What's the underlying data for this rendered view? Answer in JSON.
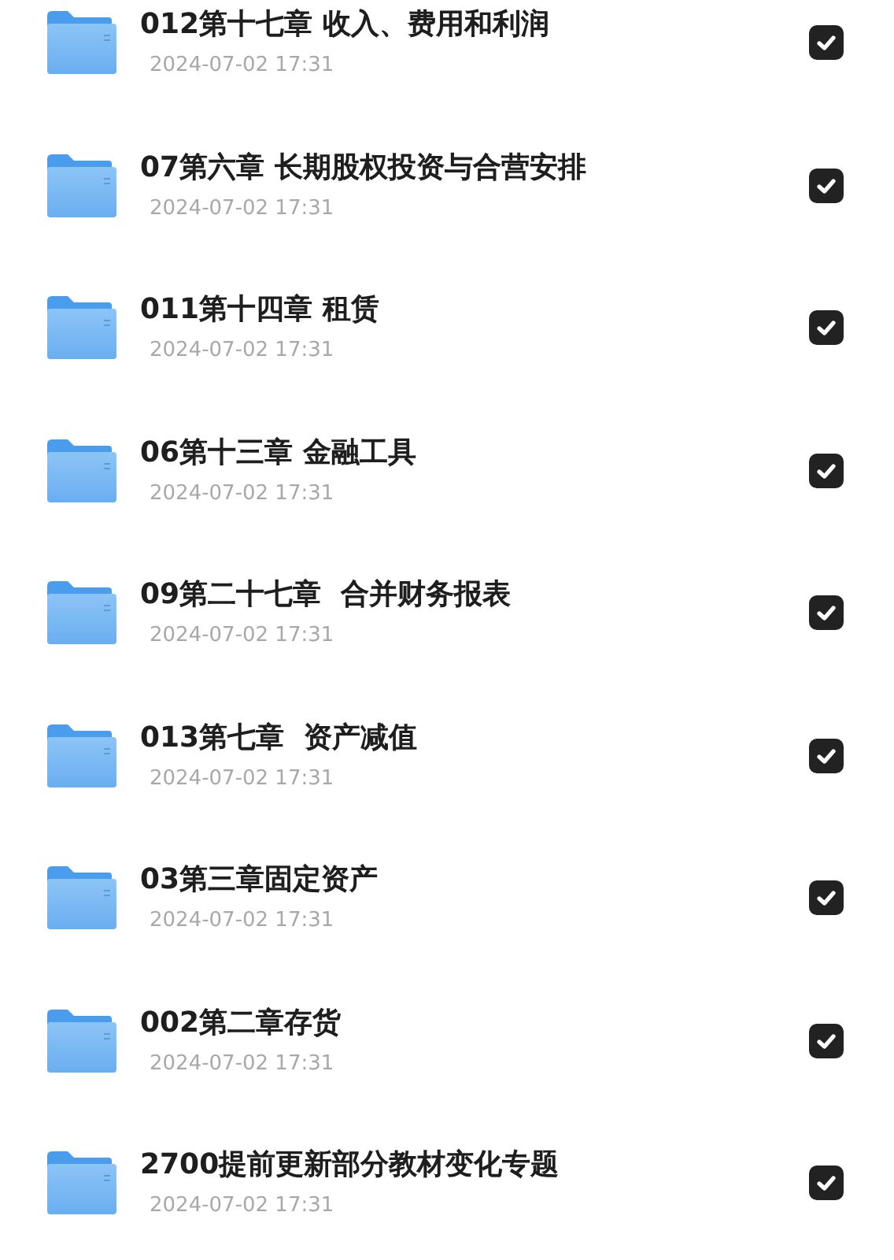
{
  "files": [
    {
      "name": "012第十七章 收入、费用和利润",
      "date": "2024-07-02 17:31",
      "checked": true
    },
    {
      "name": "07第六章 长期股权投资与合营安排",
      "date": "2024-07-02 17:31",
      "checked": true
    },
    {
      "name": "011第十四章 租赁",
      "date": "2024-07-02 17:31",
      "checked": true
    },
    {
      "name": "06第十三章 金融工具",
      "date": "2024-07-02 17:31",
      "checked": true
    },
    {
      "name": "09第二十七章  合并财务报表",
      "date": "2024-07-02 17:31",
      "checked": true
    },
    {
      "name": "013第七章  资产减值",
      "date": "2024-07-02 17:31",
      "checked": true
    },
    {
      "name": "03第三章固定资产",
      "date": "2024-07-02 17:31",
      "checked": true
    },
    {
      "name": "002第二章存货",
      "date": "2024-07-02 17:31",
      "checked": true
    },
    {
      "name": "2700提前更新部分教材变化专题",
      "date": "2024-07-02 17:31",
      "checked": true
    }
  ]
}
